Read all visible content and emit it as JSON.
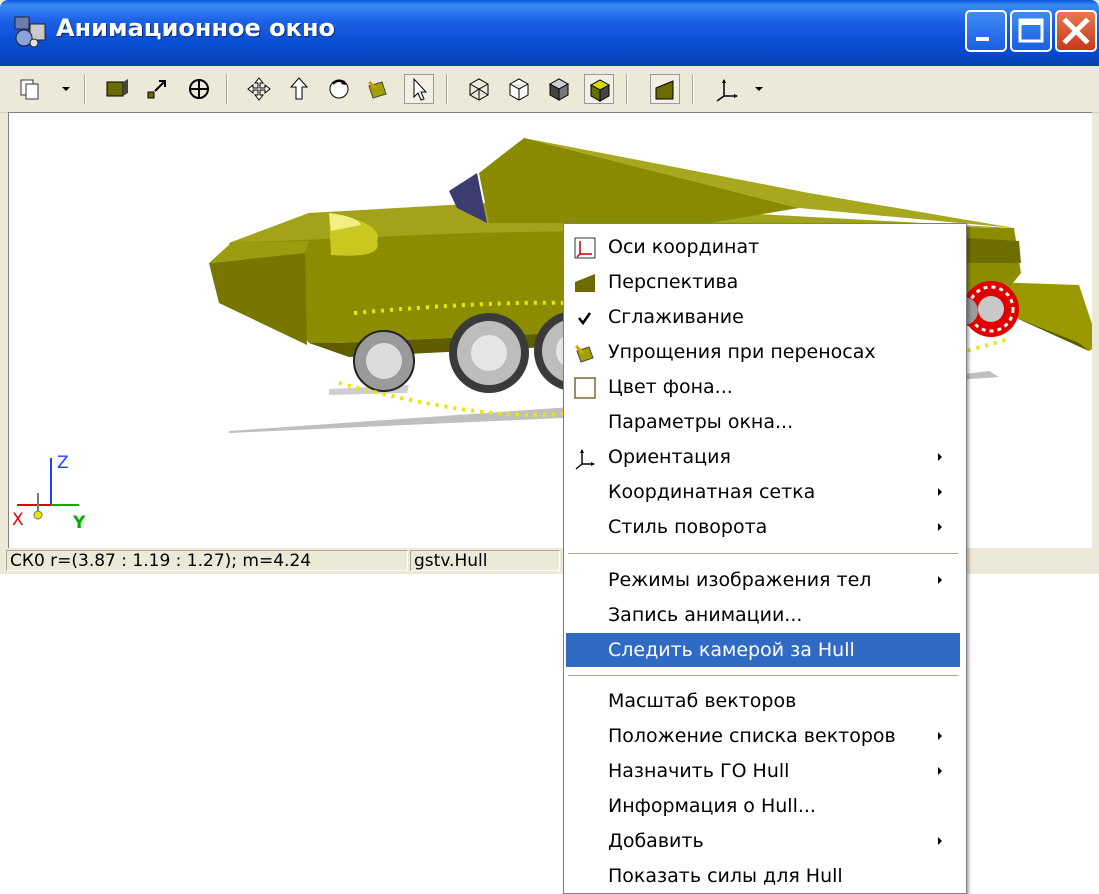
{
  "window": {
    "title": "Анимационное окно",
    "controls": [
      "minimize-icon",
      "maximize-icon",
      "close-icon"
    ]
  },
  "toolbar": {
    "buttons": [
      "copy-icon",
      "dropdown-arrow",
      "box-icon",
      "resize-icon",
      "crosshair-icon",
      "move-icon",
      "up-arrow-icon",
      "rotate-icon",
      "simplify-icon",
      "pointer-icon",
      "wireframe-cube-icon",
      "outline-cube-icon",
      "shaded-cube-icon",
      "solid-cube-icon",
      "perspective-icon",
      "axes-icon",
      "dropdown-arrow"
    ]
  },
  "viewport": {
    "axes": {
      "z": "Z",
      "x": "X",
      "y": "Y"
    }
  },
  "status": {
    "coords": "СК0 r=(3.87 : 1.19 : 1.27); m=4.24",
    "object": "gstv.Hull"
  },
  "context_menu": {
    "items": [
      {
        "label": "Оси координат",
        "icon": "axes-icon",
        "submenu": false
      },
      {
        "label": "Перспектива",
        "icon": "perspective-icon",
        "submenu": false
      },
      {
        "label": "Сглаживание",
        "icon": "checkmark-icon",
        "submenu": false
      },
      {
        "label": "Упрощения при переносах",
        "icon": "simplify-icon",
        "submenu": false
      },
      {
        "label": "Цвет фона...",
        "icon": "color-swatch-icon",
        "submenu": false
      },
      {
        "label": "Параметры окна...",
        "icon": "",
        "submenu": false
      },
      {
        "label": "Ориентация",
        "icon": "orientation-icon",
        "submenu": true
      },
      {
        "label": "Координатная сетка",
        "icon": "",
        "submenu": true
      },
      {
        "label": "Стиль поворота",
        "icon": "",
        "submenu": true
      },
      {
        "label": "Режимы изображения тел",
        "icon": "",
        "submenu": true
      },
      {
        "label": "Запись анимации...",
        "icon": "",
        "submenu": false
      },
      {
        "label": "Следить камерой за Hull",
        "icon": "",
        "submenu": false,
        "highlighted": true
      },
      {
        "label": "Масштаб векторов",
        "icon": "",
        "submenu": false
      },
      {
        "label": "Положение списка векторов",
        "icon": "",
        "submenu": true
      },
      {
        "label": "Назначить ГО Hull",
        "icon": "",
        "submenu": true
      },
      {
        "label": "Информация о Hull...",
        "icon": "",
        "submenu": false
      },
      {
        "label": "Добавить",
        "icon": "",
        "submenu": true
      },
      {
        "label": "Показать силы для Hull",
        "icon": "",
        "submenu": false
      }
    ]
  },
  "colors": {
    "titlebar": "#0a4fd4",
    "menu_highlight": "#316ac5",
    "model_olive": "#8c8c00",
    "sprocket_red": "#e00000"
  }
}
